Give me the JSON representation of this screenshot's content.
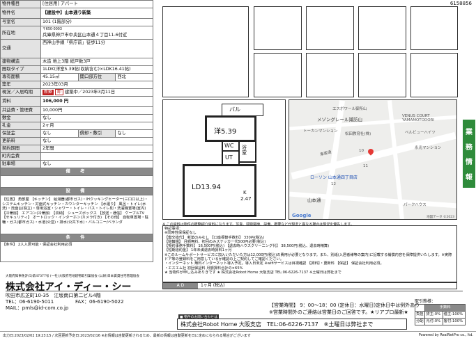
{
  "doc_id": "6158856",
  "spec": {
    "type_label": "物件種目",
    "type_value": "[住居用] アパート",
    "name_label": "物件名",
    "name_value": "【建設中】山本通り新築",
    "room_label": "号室名",
    "room_value": "101 (1階部分)",
    "addr_label": "所在地",
    "addr_zip": "〒650-0003",
    "addr_value": "兵庫県神戸市中央区山本通４丁目11-6付近",
    "traffic_label": "交通",
    "traffic_value": "西神山手線「県庁前」徒歩11分",
    "structure_label": "建物構造",
    "structure_value": "木造 地上3階 総戸数3戸",
    "layout_label": "間取タイプ",
    "layout_value": "1LDK(洋室5.39帖(収納含む)×LDK16.41帖)",
    "area_label": "専有面積",
    "area_value": "45.15㎡",
    "dir_label": "開口部方位",
    "dir_value": "西北",
    "built_label": "築年",
    "built_value": "2023年03月",
    "status_label": "現況／入居時期",
    "status_badge1": "新築",
    "status_badge2": "即",
    "status_value": "建築中／2023年3月11日",
    "rent_label": "賃料",
    "rent_value": "106,000 円",
    "common_label": "共益費・管理費",
    "common_value": "10,000円",
    "deposit_label": "敷金",
    "deposit_value": "なし",
    "key_label": "礼金",
    "key_value": "2ヶ月",
    "guar_label": "保証金",
    "guar_value": "なし",
    "shiki_label": "償却・敷引",
    "shiki_value": "なし",
    "renew_label": "更新料",
    "renew_value": "なし",
    "term_label": "契約期間",
    "term_value": "2年間",
    "assoc_label": "町内会費",
    "assoc_value": "",
    "parking_label": "駐車場",
    "parking_value": "なし",
    "remarks_header": "備　考",
    "equip_header": "設　備",
    "equip_text": "【位置】 角部屋 【キッチン】 給湯器(都市ガス)・IHクッキングヒーター(三口口以上)・システムキッチン・対面式キッチン・カウンターキッチン 【水廻り】 風呂・トイレ(水洗)・洗面台(独立)・専用浴室・シャワー・トイレ・バス・トイレ別・洗濯機置場(室内) 【冷暖房】 エアコン(冷暖房) 【収納】 シューズボックス 【放送・通信】 ケーブルTV 【セキュリティ】 オートロック・インターホン(カメラ付き) 【その他】 自転車置場・駐輪・ガス(都市ガス)・水道(公営)・排水(公共下水)・バルコニー/ベランダ",
    "cond_header": "条　件",
    "cond_text": "【条件】 2人入居可能・保証会社利用必須"
  },
  "plan": {
    "balcony": "バル",
    "western": "洋5.39",
    "wc": "WC",
    "bath": "浴室",
    "ut": "UT",
    "ldk": "LD13.94",
    "k_label": "K",
    "k_value": "2.47"
  },
  "map": {
    "l1": "エスボワール御所山",
    "l2": "メゾングレール諏訪山",
    "l3": "トーカンマンション",
    "l4": "松田教育社(株)",
    "l5": "VENUS COURT YAMAMOTODORI",
    "l6": "ベルビューハイツ",
    "l7": "永光マンション",
    "l8": "ローソン 山本通四丁目店",
    "l9": "山本通",
    "l10": "東亜通",
    "l11": "パークハウス",
    "num1": "10",
    "num2": "11",
    "num3": "12",
    "brand": "Google",
    "credit": "地図データ ©2023"
  },
  "side_tab": [
    "業",
    "務",
    "情",
    "報"
  ],
  "note_top": "※ この資料は物件の概略紹介資料になります。写真、間取図面、設備、概要などが現況と異なる場合は現況を優先します。",
  "notes_title": "特記事項：",
  "notes": [
    "※同時性保保証なし",
    "【鍵交換代】 新築のみなし 【口座振替手数料】 330円(税込)",
    "【駐輪場】 月額無料、初回のみステッカー代500円必要(税込)",
    "【契約事務手数料】 16,500円(税込) 【退去時ハウスクリーニング代】 38,500円(税込、退去時精算)",
    "【短期違約金】 1年未満退去時賃料1ヶ月",
    "※このルームサポートサービスに加入いただいた方は12,000円(税込)の費用が必要となります。また、別紙(入居者様等の案内)に記載する補償内容を保障提供いたします。※実際ドア等の登録料をご用意しているか確認の上ご契約してご確認ください。",
    "・インターネット 無料インターネット導入予定。導入日未定 ※wifiサービスは目視確認 【賃料】・更新料 【保証】 保証会社利用必須。",
    "・エスエム社 初回保証料 月額賃料合計の×65%",
    "★ 当物件が申し込みありきです ★ 株式会社Robot Home 大阪支店 TEL:06-6226-7137 ※土曜日は弊社まで"
  ],
  "ad": {
    "label": "A D",
    "value": "1ヶ月 (税込)"
  },
  "company": {
    "license": "大阪府知事免許(5)第47377号 (一社)大阪府宅地建物取引業協会 (公財)日本賃貸住宅管理協会",
    "name": "株式会社アイ・ディー・シー",
    "address": "吹田市広芝町10-35　江坂南口第二ビル4階",
    "tel": "TEL：06-6190-5011",
    "fax": "FAX：06-6190-5022",
    "mail": "MAIL：pmls@id-com.co.jp"
  },
  "hours": "【営業時間】 9：00～18：00 (定休日：水曜日)定休日中は例外あり",
  "holiday_note": "※営業時間外のご連絡は営業日のご回答です。★リアプロ最新★",
  "contact_header": "■ 物件のお問い合わせは",
  "contact_text": "株式会社Robot Home 大阪支店　TEL:06-6226-7137　※土曜日は弊社まで",
  "fee": {
    "title": "取引態様：",
    "header": "手数料",
    "r1a": "負担",
    "r1b": "貸主:0%",
    "r1c": "借主:100%",
    "r2a": "分配",
    "r2b": "元付:0%",
    "r2c": "客付:100%"
  },
  "bottom_left": "出力日:2023/02/02 19:23:15 / 次回更新予定日:2023/02/16 ※お情報は自動更新されるため、最新の情報は自動更新を日に定めになられる場合がございます",
  "bottom_right": "Powered by RealNetPro co., ltd."
}
